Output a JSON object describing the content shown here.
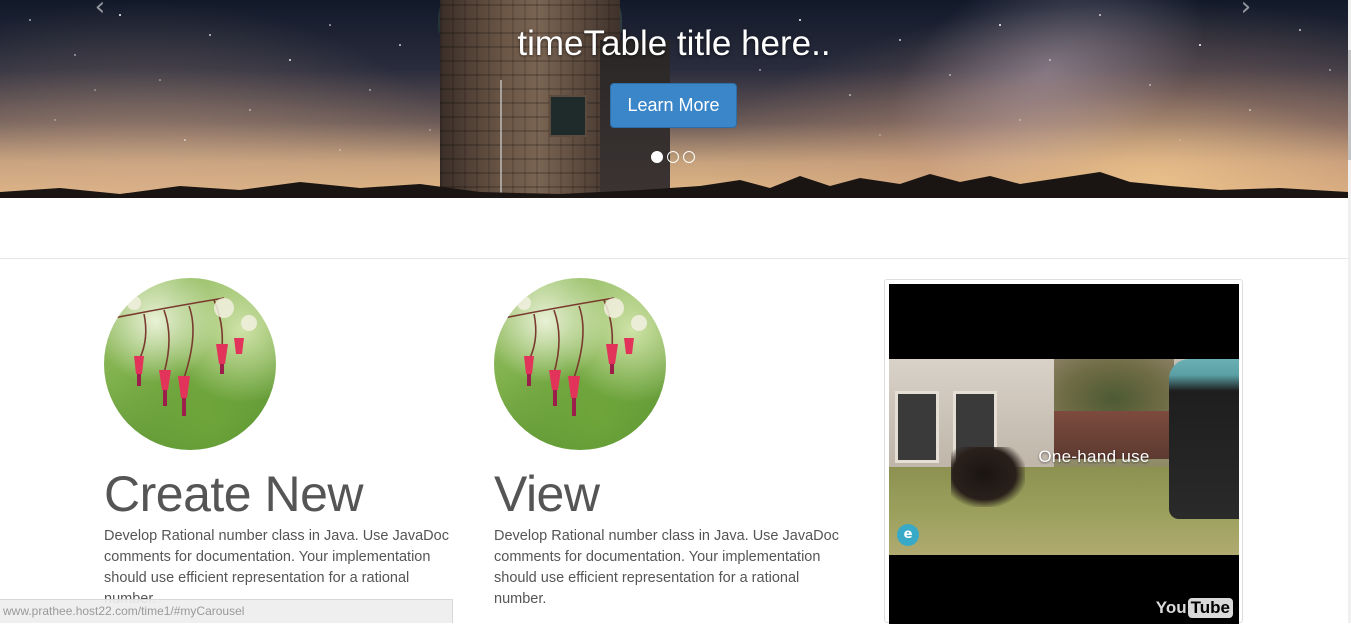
{
  "carousel": {
    "title": "timeTable title here..",
    "button_label": "Learn More",
    "indicators": [
      {
        "active": true
      },
      {
        "active": false
      },
      {
        "active": false
      }
    ],
    "prev_icon": "chevron-left-icon",
    "next_icon": "chevron-right-icon",
    "prev_glyph": "‹",
    "next_glyph": "›"
  },
  "columns": [
    {
      "heading": "Create New",
      "text": "Develop Rational number class in Java. Use JavaDoc comments for documentation. Your implementation should use efficient representation for a rational number."
    },
    {
      "heading": "View",
      "text": "Develop Rational number class in Java. Use JavaDoc comments for documentation. Your implementation should use efficient representation for a rational number."
    }
  ],
  "video": {
    "overlay_text": "One-hand use",
    "brand_icon_glyph": "e",
    "logo_you": "You",
    "logo_tube": "Tube"
  },
  "status_bar": {
    "url": "www.prathee.host22.com/time1/#myCarousel"
  },
  "colors": {
    "primary_button": "#3a86c8",
    "heading_text": "#555555",
    "body_text": "#555555"
  }
}
